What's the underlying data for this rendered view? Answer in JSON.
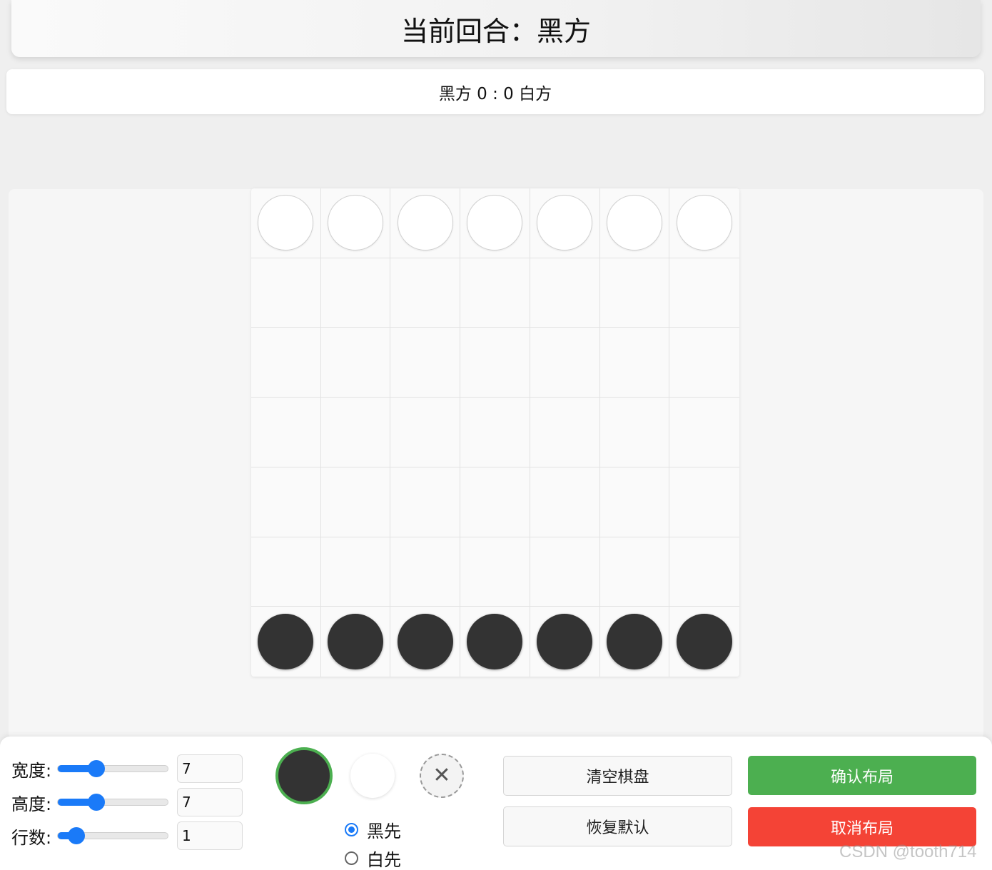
{
  "turn_banner": {
    "text": "当前回合：黑方"
  },
  "score": {
    "text": "黑方 0 : 0 白方"
  },
  "board": {
    "columns": 7,
    "rows": 7,
    "top_row": [
      "white",
      "white",
      "white",
      "white",
      "white",
      "white",
      "white"
    ],
    "bottom_row": [
      "black",
      "black",
      "black",
      "black",
      "black",
      "black",
      "black"
    ]
  },
  "controls": {
    "width": {
      "label": "宽度:",
      "value": "7",
      "slider_fraction": 0.35
    },
    "height": {
      "label": "高度:",
      "value": "7",
      "slider_fraction": 0.35
    },
    "rows": {
      "label": "行数:",
      "value": "1",
      "slider_fraction": 0.17
    },
    "piece_black": "black-piece-selected",
    "piece_white": "white-piece",
    "erase_symbol": "✕",
    "first_move": [
      {
        "label": "黑先",
        "checked": true
      },
      {
        "label": "白先",
        "checked": false
      }
    ],
    "buttons": {
      "clear": "清空棋盘",
      "reset": "恢复默认",
      "confirm": "确认布局",
      "cancel": "取消布局"
    }
  },
  "watermark": "CSDN @tooth714",
  "colors": {
    "accent": "#1a7af8",
    "confirm": "#4caf50",
    "cancel": "#f44336",
    "black_piece": "#333333"
  }
}
